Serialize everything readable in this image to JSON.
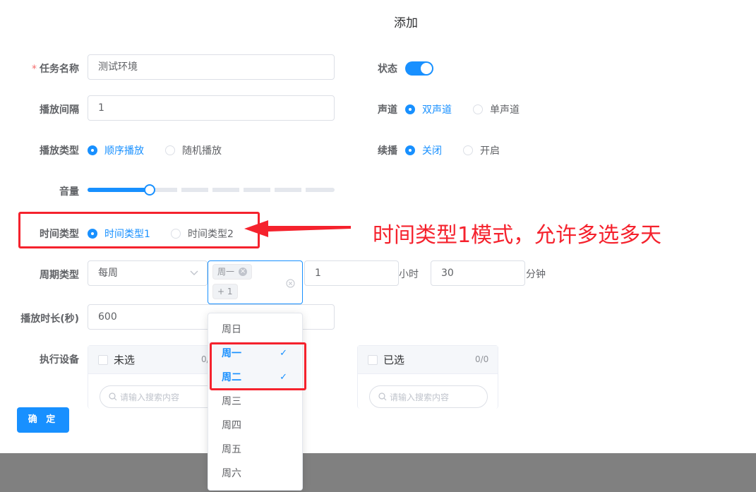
{
  "dialog": {
    "title": "添加"
  },
  "form": {
    "task_name": {
      "required_mark": "*",
      "label": "任务名称",
      "value": "测试环境"
    },
    "status": {
      "label": "状态",
      "on": true
    },
    "interval": {
      "label": "播放间隔",
      "value": "1"
    },
    "channel": {
      "label": "声道",
      "options": [
        "双声道",
        "单声道"
      ],
      "selected": "双声道"
    },
    "play_type": {
      "label": "播放类型",
      "options": [
        "顺序播放",
        "随机播放"
      ],
      "selected": "顺序播放"
    },
    "resume": {
      "label": "续播",
      "options": [
        "关闭",
        "开启"
      ],
      "selected": "关闭"
    },
    "volume": {
      "label": "音量",
      "level_fraction": 0.25
    },
    "time_type": {
      "label": "时间类型",
      "options": [
        "时间类型1",
        "时间类型2"
      ],
      "selected": "时间类型1"
    },
    "cycle": {
      "label": "周期类型",
      "select_value": "每周",
      "tags": [
        "周一"
      ],
      "more_tag": "+ 1",
      "hour_value": "1",
      "hour_unit": "小时",
      "minute_value": "30",
      "minute_unit": "分钟"
    },
    "duration": {
      "label": "播放时长(秒)",
      "value": "600"
    },
    "devices": {
      "label": "执行设备",
      "left_title": "未选",
      "left_count": "0/",
      "right_title": "已选",
      "right_count": "0/0",
      "search_placeholder": "请输入搜索内容"
    }
  },
  "confirm_button": "确 定",
  "weekday_dropdown": {
    "items": [
      {
        "label": "周日",
        "selected": false
      },
      {
        "label": "周一",
        "selected": true
      },
      {
        "label": "周二",
        "selected": true
      },
      {
        "label": "周三",
        "selected": false
      },
      {
        "label": "周四",
        "selected": false
      },
      {
        "label": "周五",
        "selected": false
      },
      {
        "label": "周六",
        "selected": false
      }
    ],
    "check_mark": "✓"
  },
  "annotation": {
    "text": "时间类型1模式，允许多选多天",
    "color": "#f5222d"
  },
  "colors": {
    "primary": "#1890ff",
    "annotation": "#f5222d",
    "overlay": "#808080"
  }
}
